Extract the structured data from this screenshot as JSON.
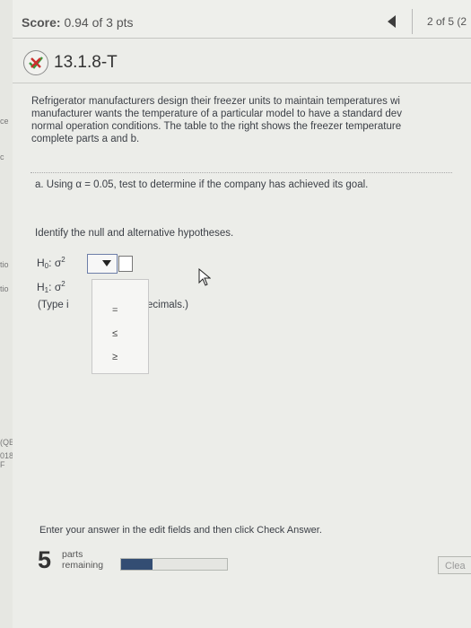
{
  "sidebar": {
    "fragments": [
      "ce",
      "c",
      "tio",
      "tio",
      "(QB",
      "018 F"
    ]
  },
  "header": {
    "score_label": "Score:",
    "score_value": "0.94 of 3 pts",
    "nav_prev_icon": "left-triangle-icon",
    "page_indicator": "2 of 5 (2"
  },
  "question": {
    "status_icon": "partial-credit-icon",
    "id": "13.1.8-T",
    "intro_lines": [
      "Refrigerator manufacturers design their freezer units to maintain temperatures wi",
      "manufacturer wants the temperature of a particular model to have a standard dev",
      "normal operation conditions. The table to the right shows the freezer temperature",
      "complete parts a and b."
    ]
  },
  "part_a": {
    "prompt": "a. Using α = 0.05, test to determine if the company has achieved its goal.",
    "instruction": "Identify the null and alternative hypotheses.",
    "h0_label": "H",
    "h0_sub": "0",
    "h1_label": "H",
    "h1_sub": "1",
    "sigma": "σ",
    "sq": "2",
    "separator": ":",
    "dropdown_options": [
      "=",
      "≤",
      "≥"
    ],
    "type_hint_start": "(Type i",
    "type_hint_end": "ecimals.)"
  },
  "footer": {
    "instructions": "Enter your answer in the edit fields and then click Check Answer.",
    "parts_count": "5",
    "parts_line1": "parts",
    "parts_line2": "remaining",
    "progress_fraction": 0.3,
    "clear_label": "Clea"
  },
  "colors": {
    "progress_fill": "#334d73",
    "select_border": "#6d7ea8",
    "icon_red": "#c9302c",
    "icon_green": "#3c9a3c"
  }
}
